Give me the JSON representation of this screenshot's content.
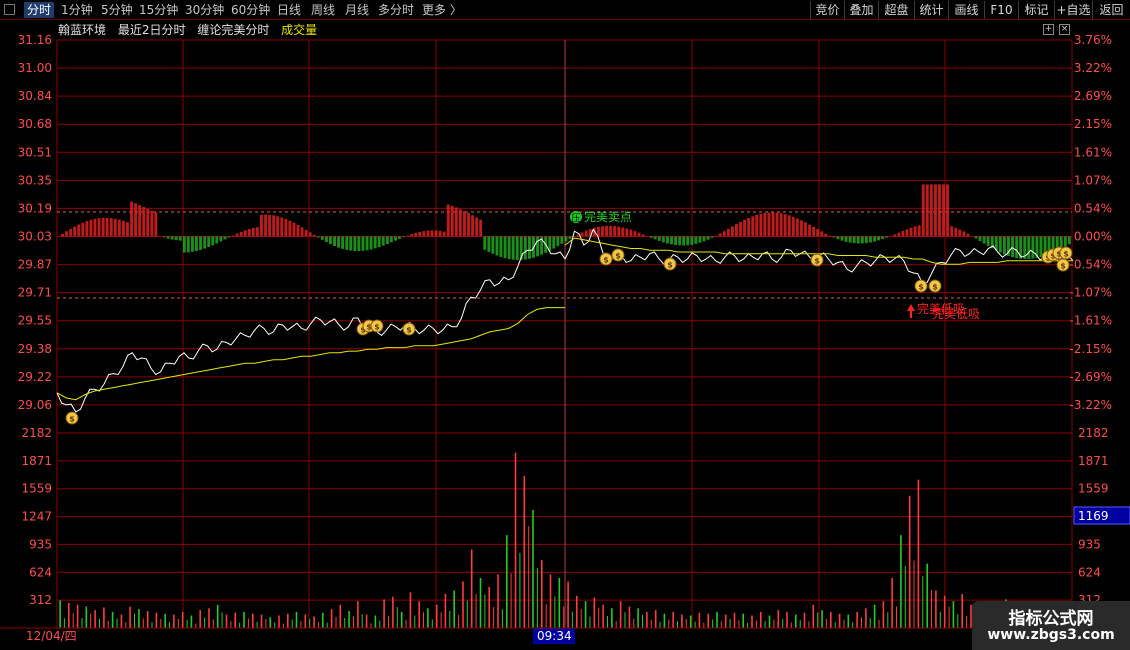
{
  "tabs": [
    {
      "label": "分时",
      "active": true
    },
    {
      "label": "1分钟"
    },
    {
      "label": "5分钟"
    },
    {
      "label": "15分钟"
    },
    {
      "label": "30分钟"
    },
    {
      "label": "60分钟"
    },
    {
      "label": "日线"
    },
    {
      "label": "周线"
    },
    {
      "label": "月线"
    },
    {
      "label": "多分时"
    },
    {
      "label": "更多 〉"
    }
  ],
  "toolbar": [
    "竞价",
    "叠加",
    "超盘",
    "统计",
    "画线",
    "F10",
    "标记",
    "+自选",
    "返回"
  ],
  "info": {
    "stock_name": "翰蓝环境",
    "period": "最近2日分时",
    "indicator": "缠论完美分时",
    "volume_label": "成交量"
  },
  "colors": {
    "bg": "#000000",
    "grid": "#8b0000",
    "price_line": "#ffffff",
    "avg_line": "#e6e600",
    "up": "#ff3b3b",
    "down": "#22cc22",
    "axis_text": "#ff4d4d",
    "signal_sell": "#22cc22",
    "signal_buy": "#ff2020",
    "cursor_box": "#0000a0"
  },
  "icons": [
    "money-bag-icon",
    "sell-signal-icon",
    "buy-arrow-icon",
    "zoom-icon",
    "close-icon"
  ],
  "chart_data": [
    {
      "type": "line",
      "name": "price",
      "y_ticks": [
        31.16,
        31.0,
        30.84,
        30.68,
        30.51,
        30.35,
        30.19,
        30.03,
        29.87,
        29.71,
        29.55,
        29.38,
        29.22,
        29.06
      ],
      "pct_ticks": [
        "3.76%",
        "3.22%",
        "2.69%",
        "2.15%",
        "1.61%",
        "1.07%",
        "0.54%",
        "0.00%",
        "-0.54%",
        "-1.07%",
        "-1.61%",
        "-2.15%",
        "-2.69%",
        "-3.22%"
      ],
      "ylim": [
        28.96,
        31.16
      ],
      "prev_close": 30.03,
      "days": [
        {
          "price": [
            29.13,
            29.06,
            29.02,
            29.1,
            29.15,
            29.18,
            29.24,
            29.28,
            29.36,
            29.33,
            29.27,
            29.25,
            29.3,
            29.34,
            29.33,
            29.37,
            29.4,
            29.38,
            29.42,
            29.44,
            29.46,
            29.49,
            29.5,
            29.48,
            29.52,
            29.51,
            29.5,
            29.53,
            29.55,
            29.54,
            29.52,
            29.51,
            29.56,
            29.5,
            29.48,
            29.49,
            29.51,
            29.52,
            29.5,
            29.49,
            29.5,
            29.49,
            29.51,
            29.56,
            29.68,
            29.72,
            29.78,
            29.76,
            29.78,
            29.86,
            29.95,
            30.0,
            29.98,
            29.93,
            29.9
          ],
          "avg": [
            29.13,
            29.1,
            29.09,
            29.12,
            29.14,
            29.15,
            29.16,
            29.17,
            29.18,
            29.19,
            29.2,
            29.21,
            29.22,
            29.23,
            29.24,
            29.25,
            29.26,
            29.27,
            29.28,
            29.29,
            29.3,
            29.3,
            29.31,
            29.32,
            29.32,
            29.33,
            29.34,
            29.34,
            29.35,
            29.36,
            29.36,
            29.37,
            29.37,
            29.38,
            29.38,
            29.39,
            29.39,
            29.39,
            29.4,
            29.4,
            29.4,
            29.41,
            29.42,
            29.43,
            29.44,
            29.46,
            29.48,
            29.49,
            29.5,
            29.53,
            29.58,
            29.61,
            29.62,
            29.62,
            29.62
          ]
        },
        {
          "price": [
            29.9,
            30.06,
            29.98,
            30.07,
            29.94,
            29.9,
            29.92,
            29.89,
            29.91,
            29.93,
            29.9,
            29.89,
            29.91,
            29.9,
            29.92,
            29.9,
            29.89,
            29.91,
            29.92,
            29.9,
            29.91,
            29.93,
            29.9,
            29.91,
            29.95,
            29.93,
            29.91,
            29.92,
            29.9,
            29.88,
            29.84,
            29.86,
            29.88,
            29.89,
            29.91,
            29.9,
            29.89,
            29.82,
            29.76,
            29.82,
            29.88,
            29.92,
            29.95,
            29.93,
            29.94,
            29.96,
            29.94,
            29.93,
            29.95,
            29.92,
            29.93,
            29.91,
            29.92,
            29.9,
            29.89
          ],
          "avg": [
            29.98,
            30.02,
            30.01,
            30.0,
            29.99,
            29.98,
            29.97,
            29.96,
            29.96,
            29.95,
            29.95,
            29.95,
            29.94,
            29.94,
            29.94,
            29.94,
            29.94,
            29.93,
            29.93,
            29.93,
            29.93,
            29.93,
            29.93,
            29.93,
            29.93,
            29.93,
            29.93,
            29.93,
            29.93,
            29.92,
            29.92,
            29.92,
            29.92,
            29.91,
            29.91,
            29.91,
            29.91,
            29.9,
            29.9,
            29.88,
            29.87,
            29.87,
            29.87,
            29.88,
            29.88,
            29.88,
            29.88,
            29.89,
            29.89,
            29.89,
            29.89,
            29.89,
            29.89,
            29.89,
            29.89
          ]
        }
      ]
    },
    {
      "type": "bar",
      "name": "volume",
      "y_ticks": [
        2182,
        1871,
        1559,
        1247,
        935,
        624,
        312
      ],
      "ylim": [
        0,
        2182
      ],
      "cursor_value": "1169",
      "days": [
        {
          "values": [
            310,
            280,
            260,
            240,
            200,
            230,
            180,
            150,
            240,
            210,
            190,
            170,
            160,
            150,
            180,
            140,
            200,
            220,
            260,
            150,
            170,
            180,
            160,
            150,
            120,
            140,
            160,
            180,
            150,
            130,
            170,
            210,
            260,
            190,
            300,
            150,
            140,
            320,
            350,
            180,
            400,
            300,
            220,
            260,
            380,
            420,
            520,
            880,
            560,
            460,
            600,
            1040,
            1960,
            1700,
            1320,
            760,
            600,
            560
          ]
        },
        {
          "values": [
            520,
            360,
            300,
            340,
            260,
            220,
            300,
            240,
            220,
            180,
            200,
            160,
            180,
            150,
            140,
            170,
            160,
            180,
            150,
            170,
            160,
            140,
            180,
            140,
            200,
            180,
            150,
            170,
            260,
            200,
            180,
            160,
            150,
            180,
            220,
            260,
            300,
            560,
            1040,
            1480,
            1660,
            720,
            420,
            360,
            300,
            380,
            260,
            200,
            240,
            180,
            320,
            220,
            170,
            190,
            200,
            260,
            180,
            250
          ]
        }
      ]
    }
  ],
  "cursor": {
    "date": "12/04/四",
    "time": "09:34"
  },
  "signals": {
    "sell_label": "完美卖点",
    "sell_badge": "压",
    "buy_label_1": "完美低吸",
    "buy_label_2": "完美低吸"
  },
  "watermark": {
    "line1": "指标公式网",
    "line2": "www.zbgs3.com"
  }
}
